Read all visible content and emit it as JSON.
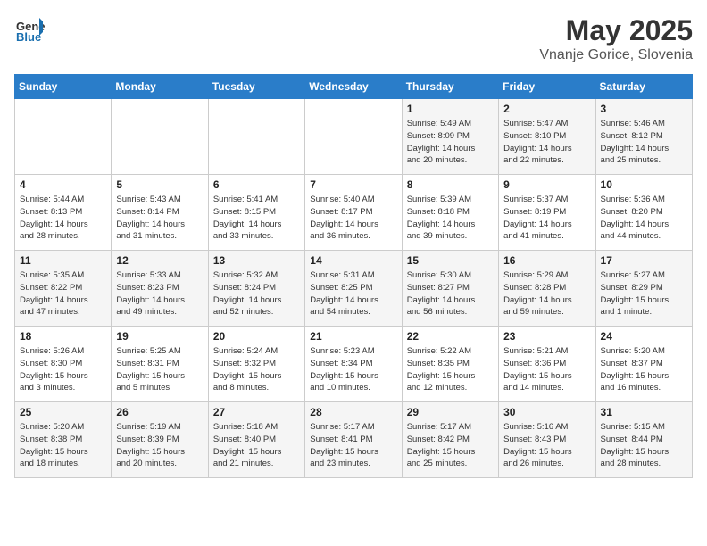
{
  "header": {
    "logo_general": "General",
    "logo_blue": "Blue",
    "title": "May 2025",
    "subtitle": "Vnanje Gorice, Slovenia"
  },
  "days_of_week": [
    "Sunday",
    "Monday",
    "Tuesday",
    "Wednesday",
    "Thursday",
    "Friday",
    "Saturday"
  ],
  "weeks": [
    [
      {
        "day": "",
        "info": ""
      },
      {
        "day": "",
        "info": ""
      },
      {
        "day": "",
        "info": ""
      },
      {
        "day": "",
        "info": ""
      },
      {
        "day": "1",
        "info": "Sunrise: 5:49 AM\nSunset: 8:09 PM\nDaylight: 14 hours\nand 20 minutes."
      },
      {
        "day": "2",
        "info": "Sunrise: 5:47 AM\nSunset: 8:10 PM\nDaylight: 14 hours\nand 22 minutes."
      },
      {
        "day": "3",
        "info": "Sunrise: 5:46 AM\nSunset: 8:12 PM\nDaylight: 14 hours\nand 25 minutes."
      }
    ],
    [
      {
        "day": "4",
        "info": "Sunrise: 5:44 AM\nSunset: 8:13 PM\nDaylight: 14 hours\nand 28 minutes."
      },
      {
        "day": "5",
        "info": "Sunrise: 5:43 AM\nSunset: 8:14 PM\nDaylight: 14 hours\nand 31 minutes."
      },
      {
        "day": "6",
        "info": "Sunrise: 5:41 AM\nSunset: 8:15 PM\nDaylight: 14 hours\nand 33 minutes."
      },
      {
        "day": "7",
        "info": "Sunrise: 5:40 AM\nSunset: 8:17 PM\nDaylight: 14 hours\nand 36 minutes."
      },
      {
        "day": "8",
        "info": "Sunrise: 5:39 AM\nSunset: 8:18 PM\nDaylight: 14 hours\nand 39 minutes."
      },
      {
        "day": "9",
        "info": "Sunrise: 5:37 AM\nSunset: 8:19 PM\nDaylight: 14 hours\nand 41 minutes."
      },
      {
        "day": "10",
        "info": "Sunrise: 5:36 AM\nSunset: 8:20 PM\nDaylight: 14 hours\nand 44 minutes."
      }
    ],
    [
      {
        "day": "11",
        "info": "Sunrise: 5:35 AM\nSunset: 8:22 PM\nDaylight: 14 hours\nand 47 minutes."
      },
      {
        "day": "12",
        "info": "Sunrise: 5:33 AM\nSunset: 8:23 PM\nDaylight: 14 hours\nand 49 minutes."
      },
      {
        "day": "13",
        "info": "Sunrise: 5:32 AM\nSunset: 8:24 PM\nDaylight: 14 hours\nand 52 minutes."
      },
      {
        "day": "14",
        "info": "Sunrise: 5:31 AM\nSunset: 8:25 PM\nDaylight: 14 hours\nand 54 minutes."
      },
      {
        "day": "15",
        "info": "Sunrise: 5:30 AM\nSunset: 8:27 PM\nDaylight: 14 hours\nand 56 minutes."
      },
      {
        "day": "16",
        "info": "Sunrise: 5:29 AM\nSunset: 8:28 PM\nDaylight: 14 hours\nand 59 minutes."
      },
      {
        "day": "17",
        "info": "Sunrise: 5:27 AM\nSunset: 8:29 PM\nDaylight: 15 hours\nand 1 minute."
      }
    ],
    [
      {
        "day": "18",
        "info": "Sunrise: 5:26 AM\nSunset: 8:30 PM\nDaylight: 15 hours\nand 3 minutes."
      },
      {
        "day": "19",
        "info": "Sunrise: 5:25 AM\nSunset: 8:31 PM\nDaylight: 15 hours\nand 5 minutes."
      },
      {
        "day": "20",
        "info": "Sunrise: 5:24 AM\nSunset: 8:32 PM\nDaylight: 15 hours\nand 8 minutes."
      },
      {
        "day": "21",
        "info": "Sunrise: 5:23 AM\nSunset: 8:34 PM\nDaylight: 15 hours\nand 10 minutes."
      },
      {
        "day": "22",
        "info": "Sunrise: 5:22 AM\nSunset: 8:35 PM\nDaylight: 15 hours\nand 12 minutes."
      },
      {
        "day": "23",
        "info": "Sunrise: 5:21 AM\nSunset: 8:36 PM\nDaylight: 15 hours\nand 14 minutes."
      },
      {
        "day": "24",
        "info": "Sunrise: 5:20 AM\nSunset: 8:37 PM\nDaylight: 15 hours\nand 16 minutes."
      }
    ],
    [
      {
        "day": "25",
        "info": "Sunrise: 5:20 AM\nSunset: 8:38 PM\nDaylight: 15 hours\nand 18 minutes."
      },
      {
        "day": "26",
        "info": "Sunrise: 5:19 AM\nSunset: 8:39 PM\nDaylight: 15 hours\nand 20 minutes."
      },
      {
        "day": "27",
        "info": "Sunrise: 5:18 AM\nSunset: 8:40 PM\nDaylight: 15 hours\nand 21 minutes."
      },
      {
        "day": "28",
        "info": "Sunrise: 5:17 AM\nSunset: 8:41 PM\nDaylight: 15 hours\nand 23 minutes."
      },
      {
        "day": "29",
        "info": "Sunrise: 5:17 AM\nSunset: 8:42 PM\nDaylight: 15 hours\nand 25 minutes."
      },
      {
        "day": "30",
        "info": "Sunrise: 5:16 AM\nSunset: 8:43 PM\nDaylight: 15 hours\nand 26 minutes."
      },
      {
        "day": "31",
        "info": "Sunrise: 5:15 AM\nSunset: 8:44 PM\nDaylight: 15 hours\nand 28 minutes."
      }
    ]
  ]
}
